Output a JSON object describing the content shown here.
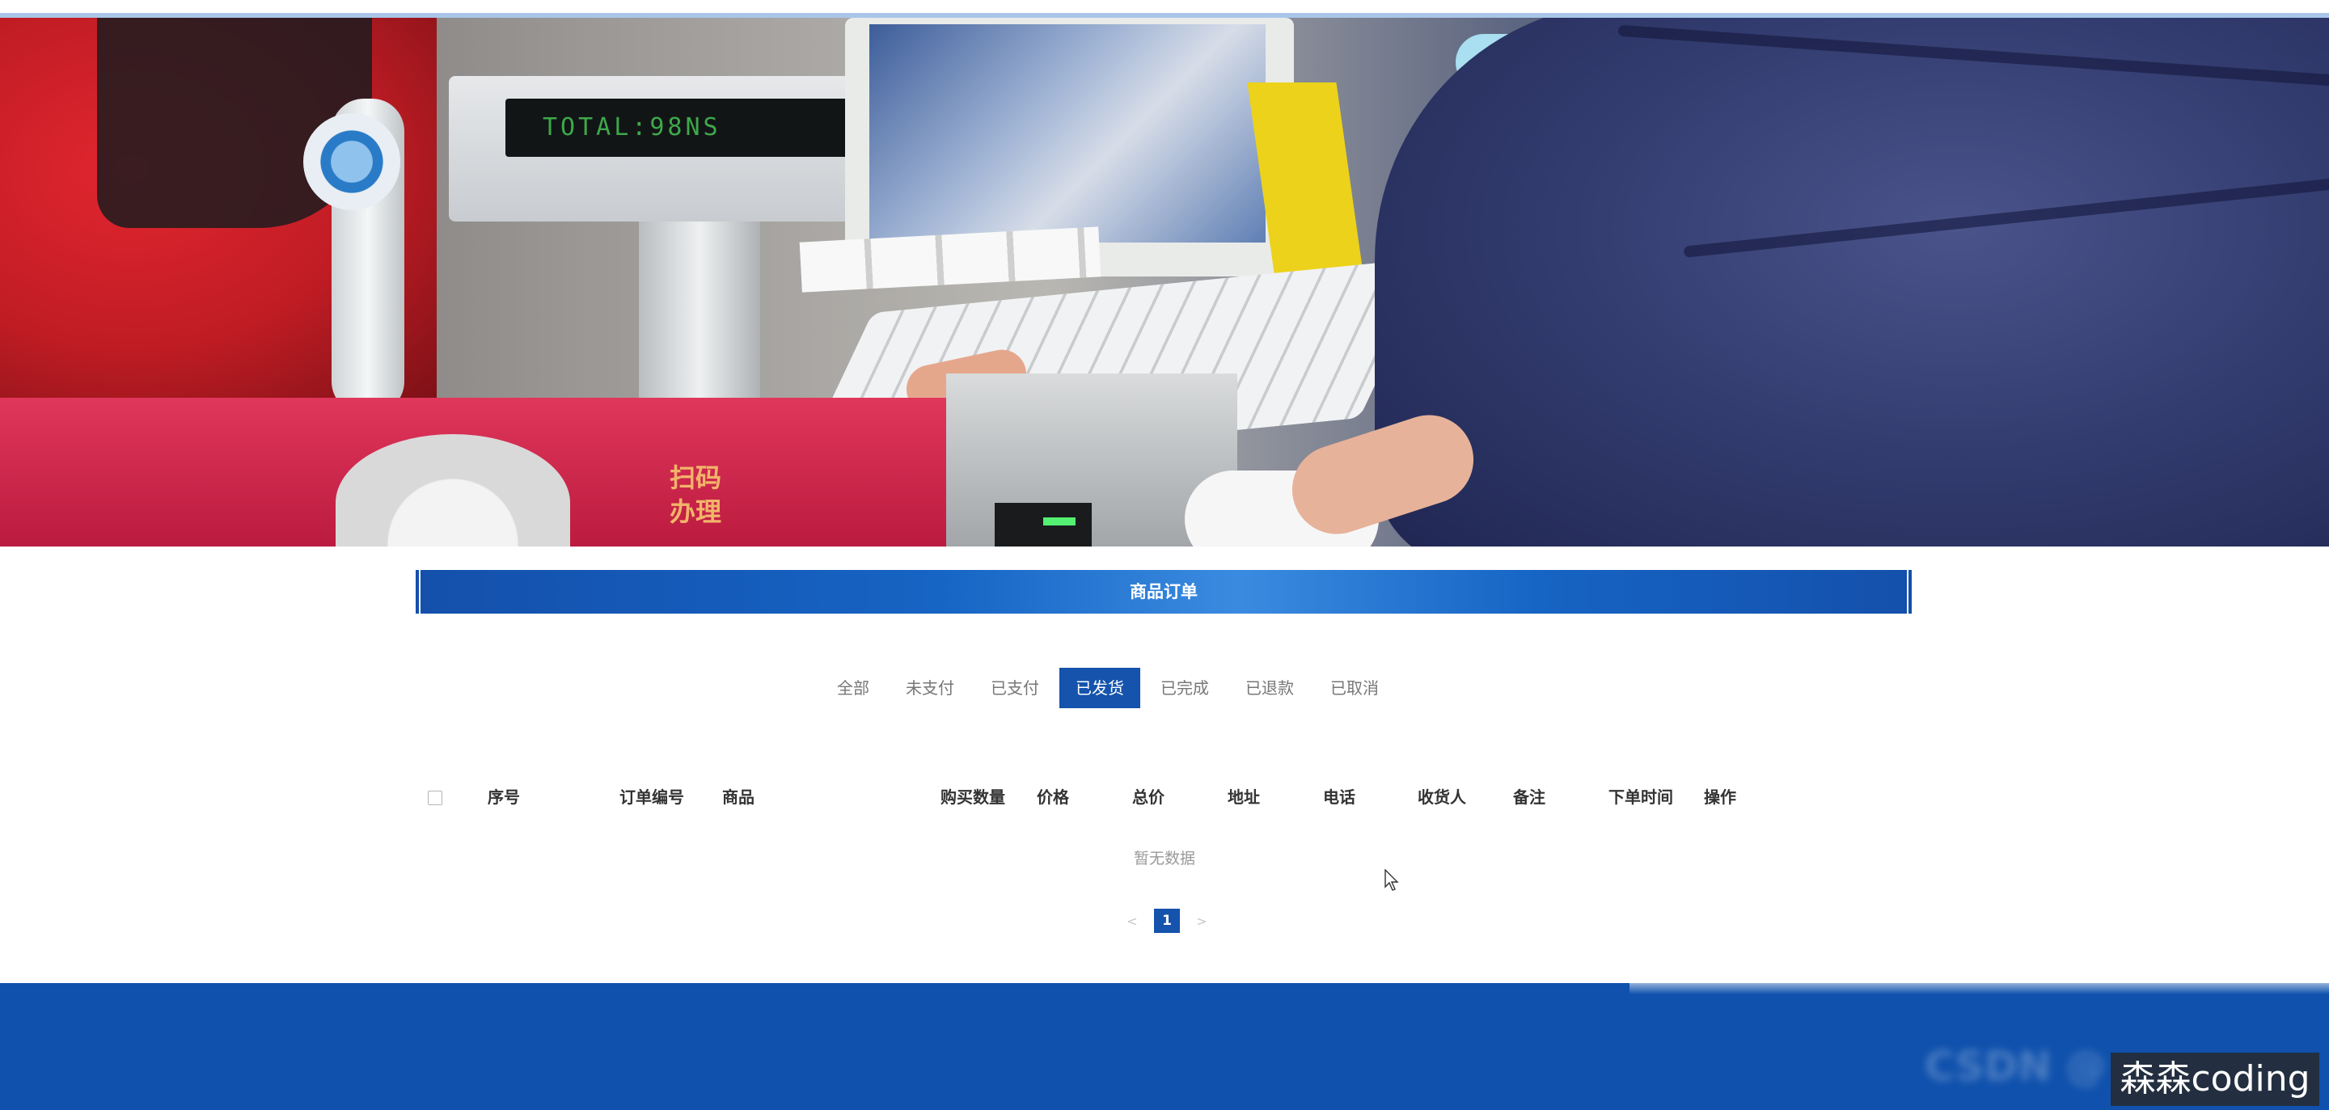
{
  "banner": {
    "pole_display_text": "TOTAL:98NS",
    "counter_sign": "扫码办理"
  },
  "section": {
    "title": "商品订单"
  },
  "tabs": [
    {
      "label": "全部",
      "active": false
    },
    {
      "label": "未支付",
      "active": false
    },
    {
      "label": "已支付",
      "active": false
    },
    {
      "label": "已发货",
      "active": true
    },
    {
      "label": "已完成",
      "active": false
    },
    {
      "label": "已退款",
      "active": false
    },
    {
      "label": "已取消",
      "active": false
    }
  ],
  "table": {
    "columns": [
      "序号",
      "订单编号",
      "商品",
      "购买数量",
      "价格",
      "总价",
      "地址",
      "电话",
      "收货人",
      "备注",
      "下单时间",
      "操作"
    ],
    "empty_text": "暂无数据"
  },
  "pagination": {
    "prev": "<",
    "current": "1",
    "next": ">"
  },
  "footer": {
    "blurred_text": "CSDN @"
  },
  "watermark": "森森coding",
  "colors": {
    "primary": "#1553ad",
    "footer": "#0f51ad"
  }
}
